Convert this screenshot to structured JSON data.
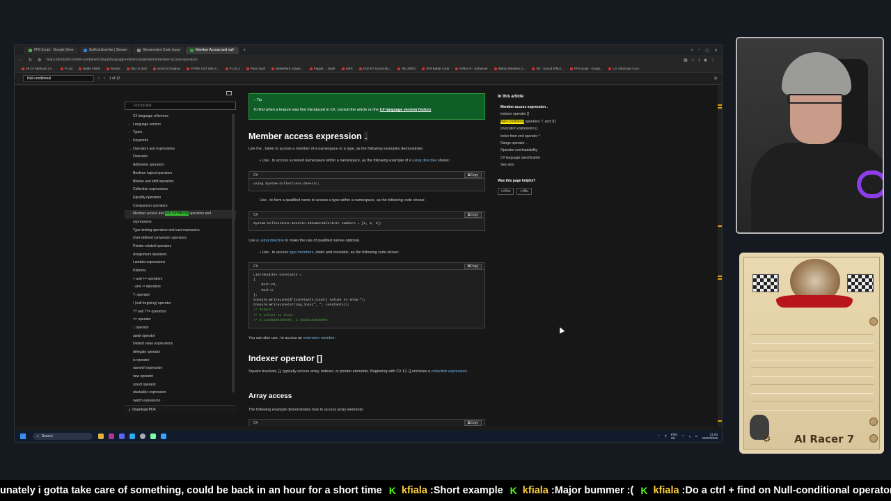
{
  "browser": {
    "tabs": [
      {
        "label": "FF9 Script - Google Shee"
      },
      {
        "label": "SetKickUserVar | Stream"
      },
      {
        "label": "Streamerbot Code Issue"
      },
      {
        "label": "Member Access and null-"
      }
    ],
    "active_tab": 3,
    "url": "learn.microsoft.com/en-us/dotnet/csharp/language-reference/operators/member-access-operators",
    "bookmarks": [
      "All C# Methods | S...",
      "P List",
      "Battle Fields",
      "Resize",
      "OBJ to 3DS",
      "Echo-S Dropbox",
      "FFIRK OST Eiko's...",
      "P List 2",
      "Pass Vault",
      "MyWelfare, Depar...",
      "Paypal → Bank",
      "AWS",
      "KOFXV Sound Mo...",
      "RE ZERO",
      "FF9 Battle Code",
      "KREA AI - Enhancer",
      "8Bitdo Wireless U...",
      "VB - Sound Effect...",
      "FF9 Script - Googl...",
      "LG UltraGear Curv..."
    ]
  },
  "findbar": {
    "query": "Null-conditional",
    "count": "1 of 12"
  },
  "sidebar": {
    "filter_placeholder": "Find by title",
    "items": [
      {
        "label": "C# language reference",
        "level": 0,
        "caret": ""
      },
      {
        "label": "Language version",
        "level": 0,
        "caret": "›"
      },
      {
        "label": "Types",
        "level": 0,
        "caret": "›"
      },
      {
        "label": "Keywords",
        "level": 0,
        "caret": "›"
      },
      {
        "label": "Operators and expressions",
        "level": 0,
        "caret": "⌄"
      },
      {
        "label": "Overview",
        "level": 1
      },
      {
        "label": "Arithmetic operators",
        "level": 1
      },
      {
        "label": "Boolean logical operators",
        "level": 1
      },
      {
        "label": "Bitwise and shift operators",
        "level": 1
      },
      {
        "label": "Collection expressions",
        "level": 1
      },
      {
        "label": "Equality operators",
        "level": 1
      },
      {
        "label": "Comparison operators",
        "level": 1
      },
      {
        "label": "Member access and",
        "level": 1,
        "highlight": "null-conditional",
        "suffix": "operators and"
      },
      {
        "label": "expressions",
        "level": 1
      },
      {
        "label": "Type-testing operators and cast expression",
        "level": 1
      },
      {
        "label": "User-defined conversion operators",
        "level": 1
      },
      {
        "label": "Pointer-related operators",
        "level": 1
      },
      {
        "label": "Assignment operators",
        "level": 1
      },
      {
        "label": "Lambda expressions",
        "level": 1
      },
      {
        "label": "Patterns",
        "level": 1
      },
      {
        "label": "+ and += operators",
        "level": 1
      },
      {
        "label": "- and -= operators",
        "level": 1
      },
      {
        "label": "?: operator",
        "level": 1
      },
      {
        "label": "! (null-forgiving) operator",
        "level": 1
      },
      {
        "label": "?? and ??= operators",
        "level": 1
      },
      {
        "label": "=> operator",
        "level": 1
      },
      {
        "label": ":: operator",
        "level": 1
      },
      {
        "label": "await operator",
        "level": 1
      },
      {
        "label": "Default value expressions",
        "level": 1
      },
      {
        "label": "delegate operator",
        "level": 1
      },
      {
        "label": "is operator",
        "level": 1
      },
      {
        "label": "nameof expression",
        "level": 1
      },
      {
        "label": "new operator",
        "level": 1
      },
      {
        "label": "sizeof operator",
        "level": 1
      },
      {
        "label": "stackalloc expression",
        "level": 1
      },
      {
        "label": "switch expression",
        "level": 1
      }
    ],
    "download": "Download PDF"
  },
  "article": {
    "tip_title": "Tip",
    "tip_text": "To find when a feature was first introduced in C#, consult the article on the",
    "tip_link": "C# language version history",
    "h_member": "Member access expression",
    "h_member_token": ".",
    "p_member": "Use the . token to access a member of a namespace or a type, as the following examples demonstrate:",
    "b1": "Use . to access a nested namespace within a namespace, as the following example of a",
    "b1_link": "using directive",
    "b1_end": "shows:",
    "code_lang": "C#",
    "copy": "Copy",
    "code1": "using System.Collections.Generic;",
    "b2": "Use . to form a qualified name to access a type within a namespace, as the following code shows:",
    "code2": "System.Collections.Generic.IEnumerable<int> numbers = [1, 2, 3];",
    "p_use": "Use a",
    "p_use_link": "using directive",
    "p_use_end": "to make the use of qualified names optional.",
    "b3": "Use . to access",
    "b3_link": "type members",
    "b3_end": ", static and nonstatic, as the following code shows:",
    "code3_lines": [
      "List<double> constants =",
      "[",
      "    Math.PI,",
      "    Math.E",
      "];",
      "Console.WriteLine($\"{constants.Count} values to show:\");",
      "Console.WriteLine(string.Join(\", \", constants));",
      "// Output:",
      "// 2 values to show:",
      "// 3.14159265358979, 2.71828182845905"
    ],
    "p_ext": "You can also use . to access an",
    "p_ext_link": "extension member",
    "h_indexer": "Indexer operator []",
    "p_indexer": "Square brackets, [], typically access array, indexer, or pointer elements. Beginning with C# 12, [] encloses a",
    "p_indexer_link": "collection expression",
    "h_array": "Array access",
    "p_array": "The following example demonstrates how to access array elements:"
  },
  "in_this_article": {
    "title": "In this article",
    "items": [
      "Member access expression .",
      "Indexer operator []",
      "Null-conditional operators ?. and ?[]",
      "Invocation expression ()",
      "Index from end operator ^",
      "Range operator ..",
      "Operator overloadability",
      "C# language specification",
      "See also"
    ],
    "helpful": "Was this page helpful?",
    "yes": "Yes",
    "no": "No"
  },
  "taskbar": {
    "search": "Search",
    "lang": "ENG",
    "region": "UK",
    "time": "21:00",
    "date": "23/03/2026"
  },
  "game": {
    "title": "AI Racer 7"
  },
  "ticker": {
    "prefix": "unately i gotta take care of something, could be back in an hour for a short time",
    "messages": [
      {
        "user": "kfiala",
        "text": "Short example"
      },
      {
        "user": "kfiala",
        "text": "Major bummer :("
      },
      {
        "user": "kfiala",
        "text": "Do a ctrl + find on Null-conditional operators"
      }
    ]
  },
  "colors": {
    "tip_bg": "#0f5d27",
    "find_highlight": "#ffe900",
    "active_match": "#36c436",
    "link": "#75b6e7",
    "kick_green": "#53fc18",
    "username": "#ffd23a"
  }
}
